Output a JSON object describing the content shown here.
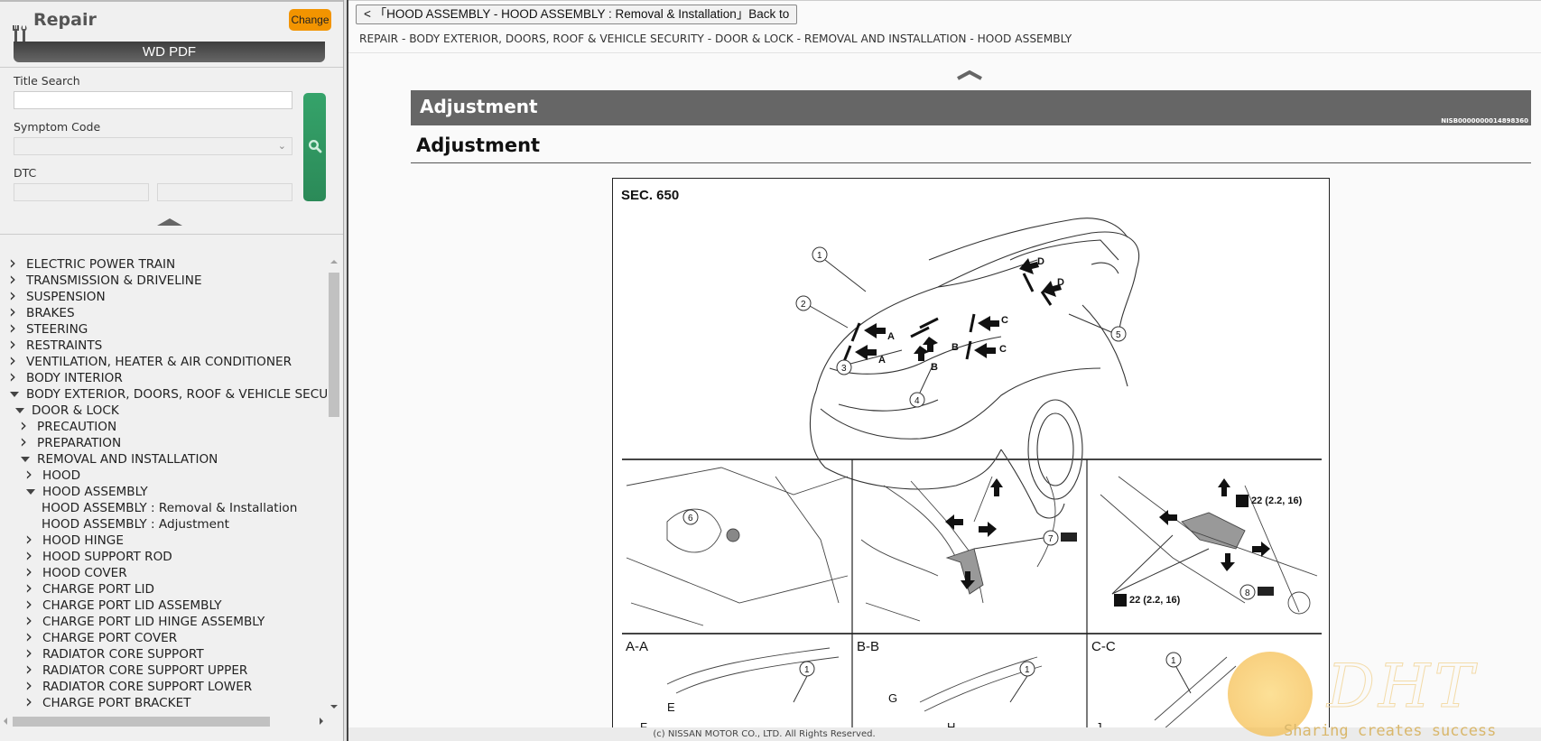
{
  "sidebar": {
    "title": "Repair",
    "change_label": "Change",
    "wd_pdf_label": "WD PDF",
    "title_search": {
      "label": "Title Search",
      "value": "",
      "placeholder": ""
    },
    "symptom_code": {
      "label": "Symptom Code",
      "selected": ""
    },
    "dtc": {
      "label": "DTC",
      "value1": "",
      "value2": ""
    },
    "tree": [
      {
        "label": "ELECTRIC POWER TRAIN",
        "level": 0,
        "state": "closed"
      },
      {
        "label": "TRANSMISSION & DRIVELINE",
        "level": 0,
        "state": "closed"
      },
      {
        "label": "SUSPENSION",
        "level": 0,
        "state": "closed"
      },
      {
        "label": "BRAKES",
        "level": 0,
        "state": "closed"
      },
      {
        "label": "STEERING",
        "level": 0,
        "state": "closed"
      },
      {
        "label": "RESTRAINTS",
        "level": 0,
        "state": "closed"
      },
      {
        "label": "VENTILATION, HEATER & AIR CONDITIONER",
        "level": 0,
        "state": "closed"
      },
      {
        "label": "BODY INTERIOR",
        "level": 0,
        "state": "closed"
      },
      {
        "label": "BODY EXTERIOR, DOORS, ROOF & VEHICLE SECURITY",
        "level": 0,
        "state": "open"
      },
      {
        "label": "DOOR & LOCK",
        "level": 1,
        "state": "open"
      },
      {
        "label": "PRECAUTION",
        "level": 2,
        "state": "closed"
      },
      {
        "label": "PREPARATION",
        "level": 2,
        "state": "closed"
      },
      {
        "label": "REMOVAL AND INSTALLATION",
        "level": 2,
        "state": "open"
      },
      {
        "label": "HOOD",
        "level": 3,
        "state": "closed"
      },
      {
        "label": "HOOD ASSEMBLY",
        "level": 3,
        "state": "open"
      },
      {
        "label": "HOOD ASSEMBLY : Removal & Installation",
        "level": 4,
        "state": "leaf"
      },
      {
        "label": "HOOD ASSEMBLY : Adjustment",
        "level": 4,
        "state": "leaf"
      },
      {
        "label": "HOOD HINGE",
        "level": 3,
        "state": "closed"
      },
      {
        "label": "HOOD SUPPORT ROD",
        "level": 3,
        "state": "closed"
      },
      {
        "label": "HOOD COVER",
        "level": 3,
        "state": "closed"
      },
      {
        "label": "CHARGE PORT LID",
        "level": 3,
        "state": "closed"
      },
      {
        "label": "CHARGE PORT LID ASSEMBLY",
        "level": 3,
        "state": "closed"
      },
      {
        "label": "CHARGE PORT LID HINGE ASSEMBLY",
        "level": 3,
        "state": "closed"
      },
      {
        "label": "CHARGE PORT COVER",
        "level": 3,
        "state": "closed"
      },
      {
        "label": "RADIATOR CORE SUPPORT",
        "level": 3,
        "state": "closed"
      },
      {
        "label": "RADIATOR CORE SUPPORT UPPER",
        "level": 3,
        "state": "closed"
      },
      {
        "label": "RADIATOR CORE SUPPORT LOWER",
        "level": 3,
        "state": "closed"
      },
      {
        "label": "CHARGE PORT BRACKET",
        "level": 3,
        "state": "closed"
      }
    ]
  },
  "main": {
    "back_button": "<  「HOOD ASSEMBLY - HOOD ASSEMBLY : Removal & Installation」Back to",
    "breadcrumb": "REPAIR - BODY EXTERIOR, DOORS, ROOF & VEHICLE SECURITY - DOOR & LOCK - REMOVAL AND INSTALLATION - HOOD ASSEMBLY",
    "section_title": "Adjustment",
    "section_id": "NISB0000000014898360",
    "subtitle": "Adjustment",
    "figure": {
      "section": "SEC. 650",
      "callouts": [
        "1",
        "2",
        "3",
        "4",
        "5",
        "6",
        "7",
        "8"
      ],
      "view_letters": [
        "A",
        "A",
        "B",
        "B",
        "C",
        "C",
        "D",
        "D"
      ],
      "panels": [
        "A-A",
        "B-B",
        "C-C"
      ],
      "torque_1": "22 (2.2, 16)",
      "torque_2": "22 (2.2, 16)"
    }
  },
  "footer": "(c) NISSAN MOTOR CO., LTD. All Rights Reserved.",
  "watermark": {
    "brand": "DHT",
    "tagline": "Sharing creates success"
  }
}
